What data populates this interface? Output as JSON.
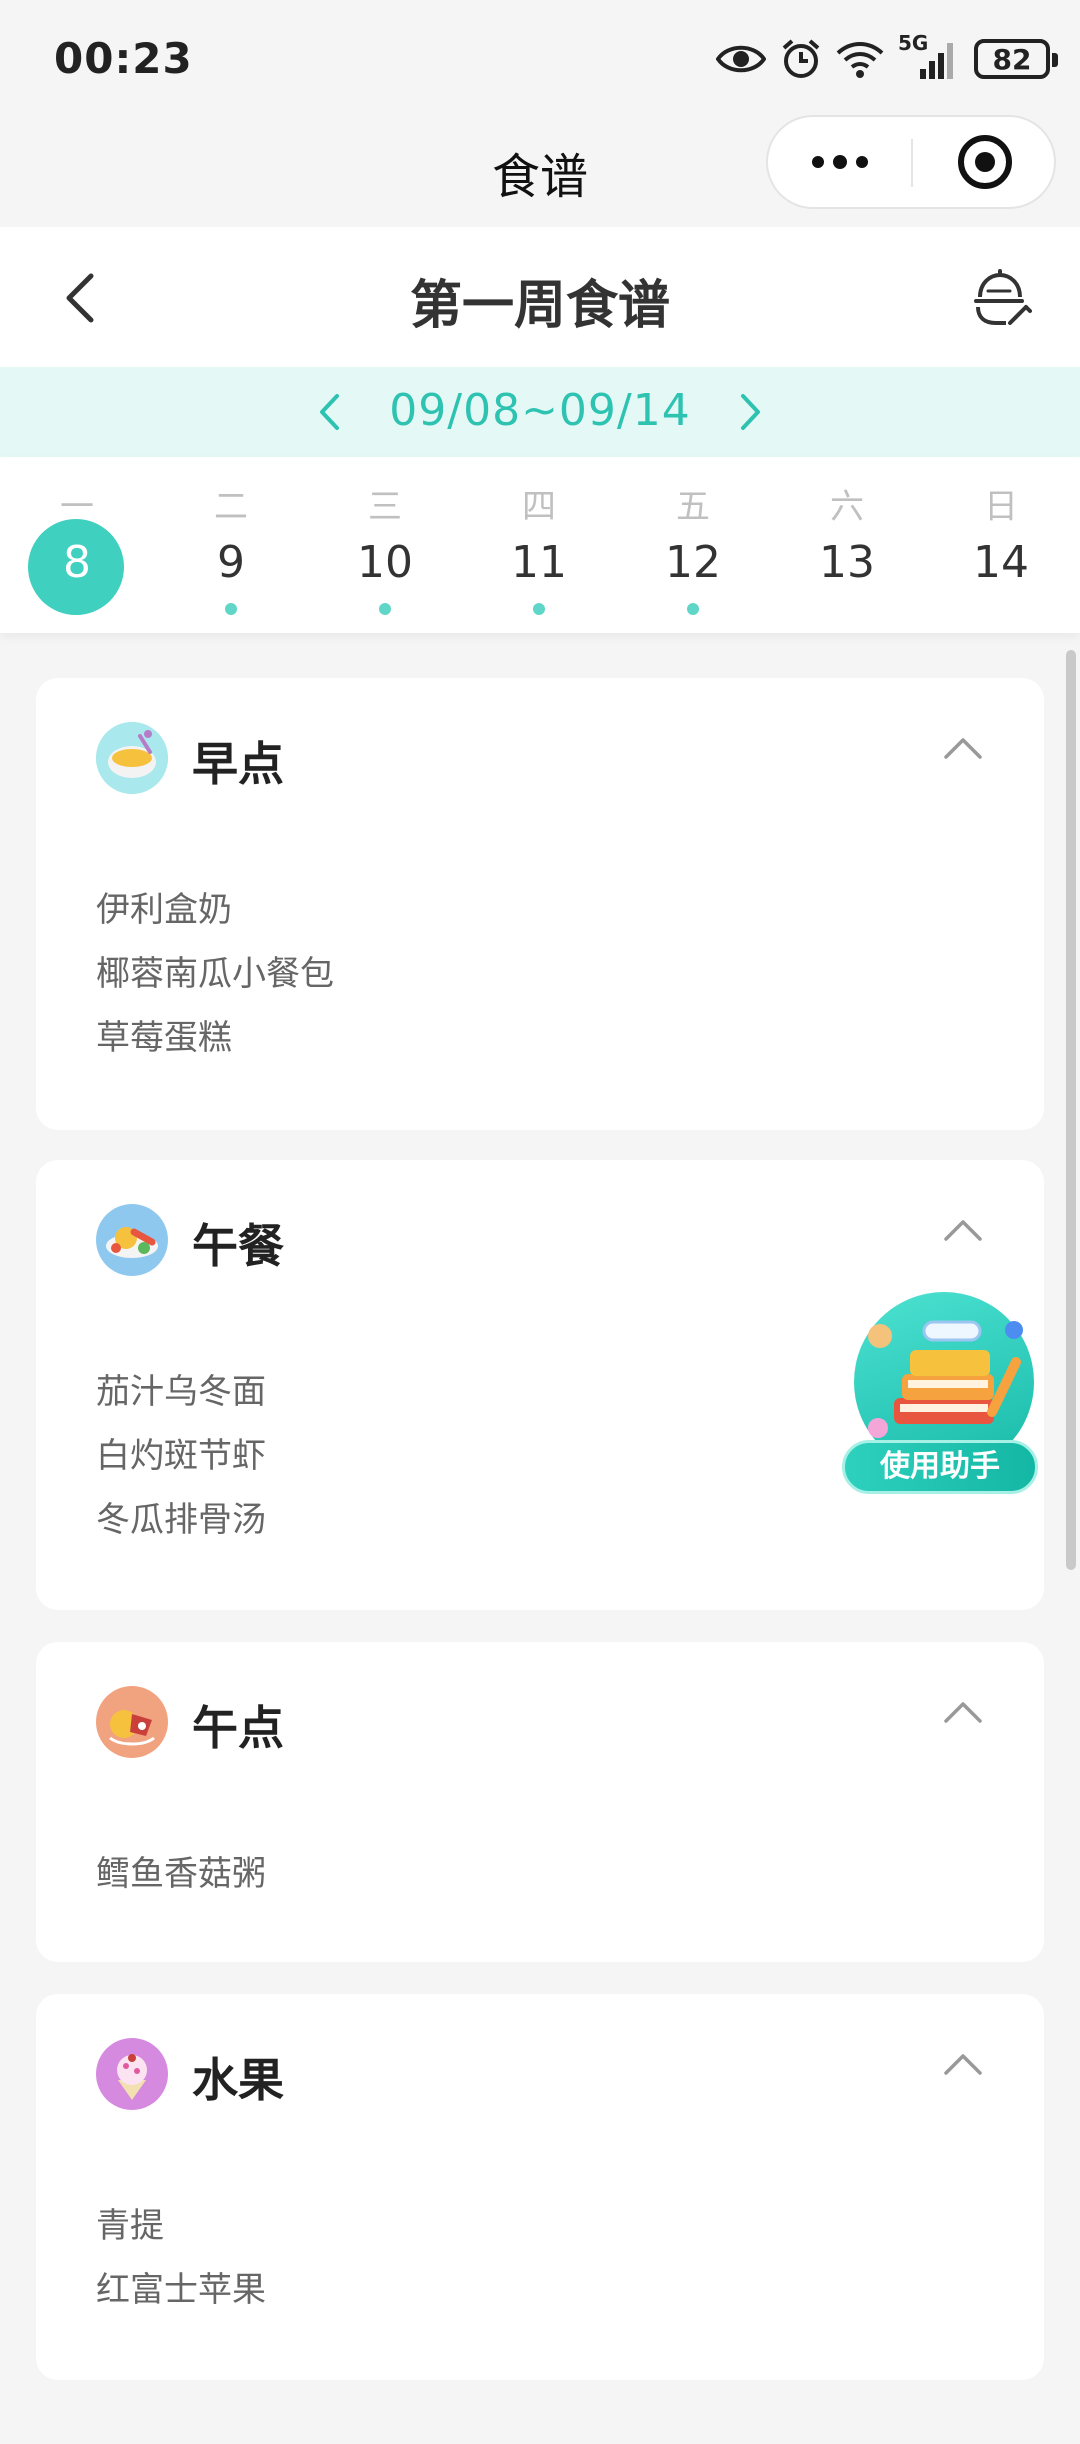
{
  "status_bar": {
    "time": "00:23",
    "network": "5G",
    "battery": "82"
  },
  "mini_program": {
    "title": "食谱"
  },
  "header": {
    "title": "第一周食谱"
  },
  "week": {
    "range": "09/08~09/14"
  },
  "days": [
    {
      "weekday": "一",
      "date": "8",
      "selected": true,
      "has_menu": false
    },
    {
      "weekday": "二",
      "date": "9",
      "selected": false,
      "has_menu": true
    },
    {
      "weekday": "三",
      "date": "10",
      "selected": false,
      "has_menu": true
    },
    {
      "weekday": "四",
      "date": "11",
      "selected": false,
      "has_menu": true
    },
    {
      "weekday": "五",
      "date": "12",
      "selected": false,
      "has_menu": true
    },
    {
      "weekday": "六",
      "date": "13",
      "selected": false,
      "has_menu": false
    },
    {
      "weekday": "日",
      "date": "14",
      "selected": false,
      "has_menu": false
    }
  ],
  "meals": [
    {
      "title": "早点",
      "icon": "soup-bowl-icon",
      "items": [
        "伊利盒奶",
        "椰蓉南瓜小餐包",
        "草莓蛋糕"
      ]
    },
    {
      "title": "午餐",
      "icon": "lunch-plate-icon",
      "items": [
        "茄汁乌冬面",
        "白灼斑节虾",
        "冬瓜排骨汤"
      ]
    },
    {
      "title": "午点",
      "icon": "snack-icon",
      "items": [
        "鳕鱼香菇粥"
      ]
    },
    {
      "title": "水果",
      "icon": "fruit-cake-icon",
      "items": [
        "青提",
        "红富士苹果"
      ]
    }
  ],
  "assistant": {
    "label": "使用助手"
  },
  "colors": {
    "accent": "#3fd0c0",
    "week_bar_bg": "#e4f9f6",
    "page_bg": "#f5f5f5"
  }
}
